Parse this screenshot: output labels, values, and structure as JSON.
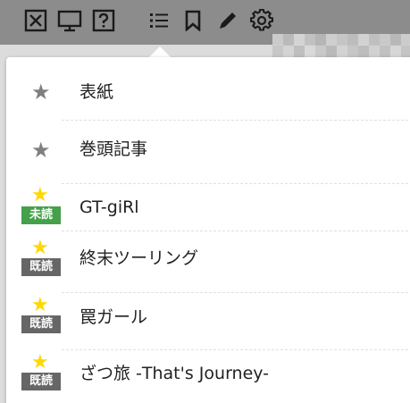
{
  "toolbar": {
    "buttons": [
      {
        "icon": "close-box-icon"
      },
      {
        "icon": "monitor-icon"
      },
      {
        "icon": "help-icon"
      },
      {
        "icon": "list-icon"
      },
      {
        "icon": "bookmark-icon"
      },
      {
        "icon": "pencil-icon"
      },
      {
        "icon": "gear-icon"
      }
    ],
    "icon_color": "#1a1a1a"
  },
  "menu": {
    "items": [
      {
        "title": "表紙",
        "star": "gray",
        "status": ""
      },
      {
        "title": "巻頭記事",
        "star": "gray",
        "status": ""
      },
      {
        "title": "GT-giRl",
        "star": "gold",
        "status": "未読"
      },
      {
        "title": "終末ツーリング",
        "star": "gold",
        "status": "既読"
      },
      {
        "title": "罠ガール",
        "star": "gold",
        "status": "既読"
      },
      {
        "title": "ざつ旅 -That's Journey-",
        "star": "gold",
        "status": "既読"
      }
    ]
  },
  "colors": {
    "unread_badge": "#45a04a",
    "read_badge": "#666666",
    "gold_star": "#ffd800",
    "gray_star": "#7f7f7f"
  }
}
